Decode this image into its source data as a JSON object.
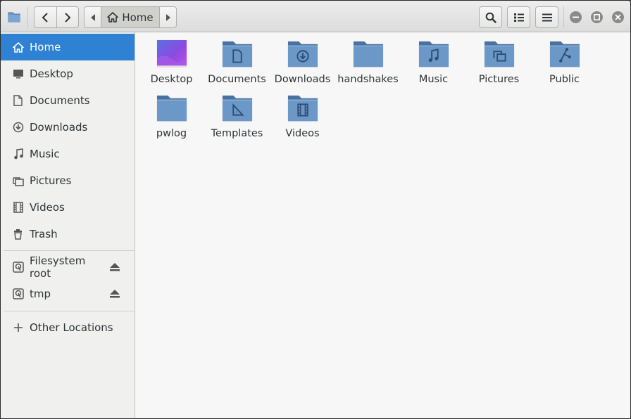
{
  "header": {
    "path_current": "Home"
  },
  "sidebar": {
    "items": [
      {
        "label": "Home",
        "icon": "home-icon",
        "active": true
      },
      {
        "label": "Desktop",
        "icon": "desktop-icon"
      },
      {
        "label": "Documents",
        "icon": "document-icon"
      },
      {
        "label": "Downloads",
        "icon": "download-icon"
      },
      {
        "label": "Music",
        "icon": "music-icon"
      },
      {
        "label": "Pictures",
        "icon": "pictures-icon"
      },
      {
        "label": "Videos",
        "icon": "video-icon"
      },
      {
        "label": "Trash",
        "icon": "trash-icon"
      }
    ],
    "devices": [
      {
        "label": "Filesystem root",
        "icon": "drive-icon",
        "eject": true
      },
      {
        "label": "tmp",
        "icon": "drive-icon",
        "eject": true
      }
    ],
    "other": {
      "label": "Other Locations",
      "icon": "plus-icon"
    }
  },
  "files": [
    {
      "name": "Desktop",
      "icon": "desktop-folder"
    },
    {
      "name": "Documents",
      "icon": "documents-folder"
    },
    {
      "name": "Downloads",
      "icon": "downloads-folder"
    },
    {
      "name": "handshakes",
      "icon": "folder"
    },
    {
      "name": "Music",
      "icon": "music-folder"
    },
    {
      "name": "Pictures",
      "icon": "pictures-folder"
    },
    {
      "name": "Public",
      "icon": "public-folder"
    },
    {
      "name": "pwlog",
      "icon": "folder"
    },
    {
      "name": "Templates",
      "icon": "templates-folder"
    },
    {
      "name": "Videos",
      "icon": "videos-folder"
    }
  ],
  "colors": {
    "accent": "#2f82d3",
    "folder": "#6c98c8",
    "folder_dark": "#4a72a0"
  }
}
